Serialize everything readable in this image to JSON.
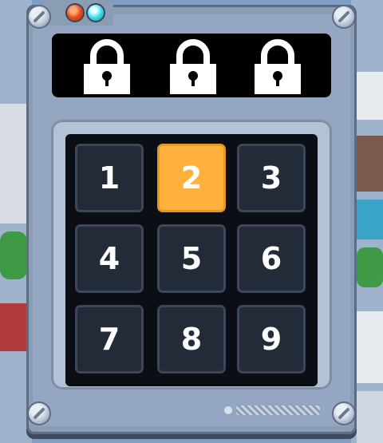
{
  "colors": {
    "frame": "#8b9cb5",
    "keypad_bg": "#0b0e14",
    "key_bg": "#232b38",
    "key_active": "#ffb13b",
    "led_red": "#e8501c",
    "led_cyan": "#3ee0ee"
  },
  "locks": [
    {
      "icon": "padlock-locked-icon",
      "state": "locked"
    },
    {
      "icon": "padlock-locked-icon",
      "state": "locked"
    },
    {
      "icon": "padlock-locked-icon",
      "state": "locked"
    }
  ],
  "keypad": {
    "keys": [
      {
        "label": "1",
        "active": false
      },
      {
        "label": "2",
        "active": true
      },
      {
        "label": "3",
        "active": false
      },
      {
        "label": "4",
        "active": false
      },
      {
        "label": "5",
        "active": false
      },
      {
        "label": "6",
        "active": false
      },
      {
        "label": "7",
        "active": false
      },
      {
        "label": "8",
        "active": false
      },
      {
        "label": "9",
        "active": false
      }
    ]
  }
}
